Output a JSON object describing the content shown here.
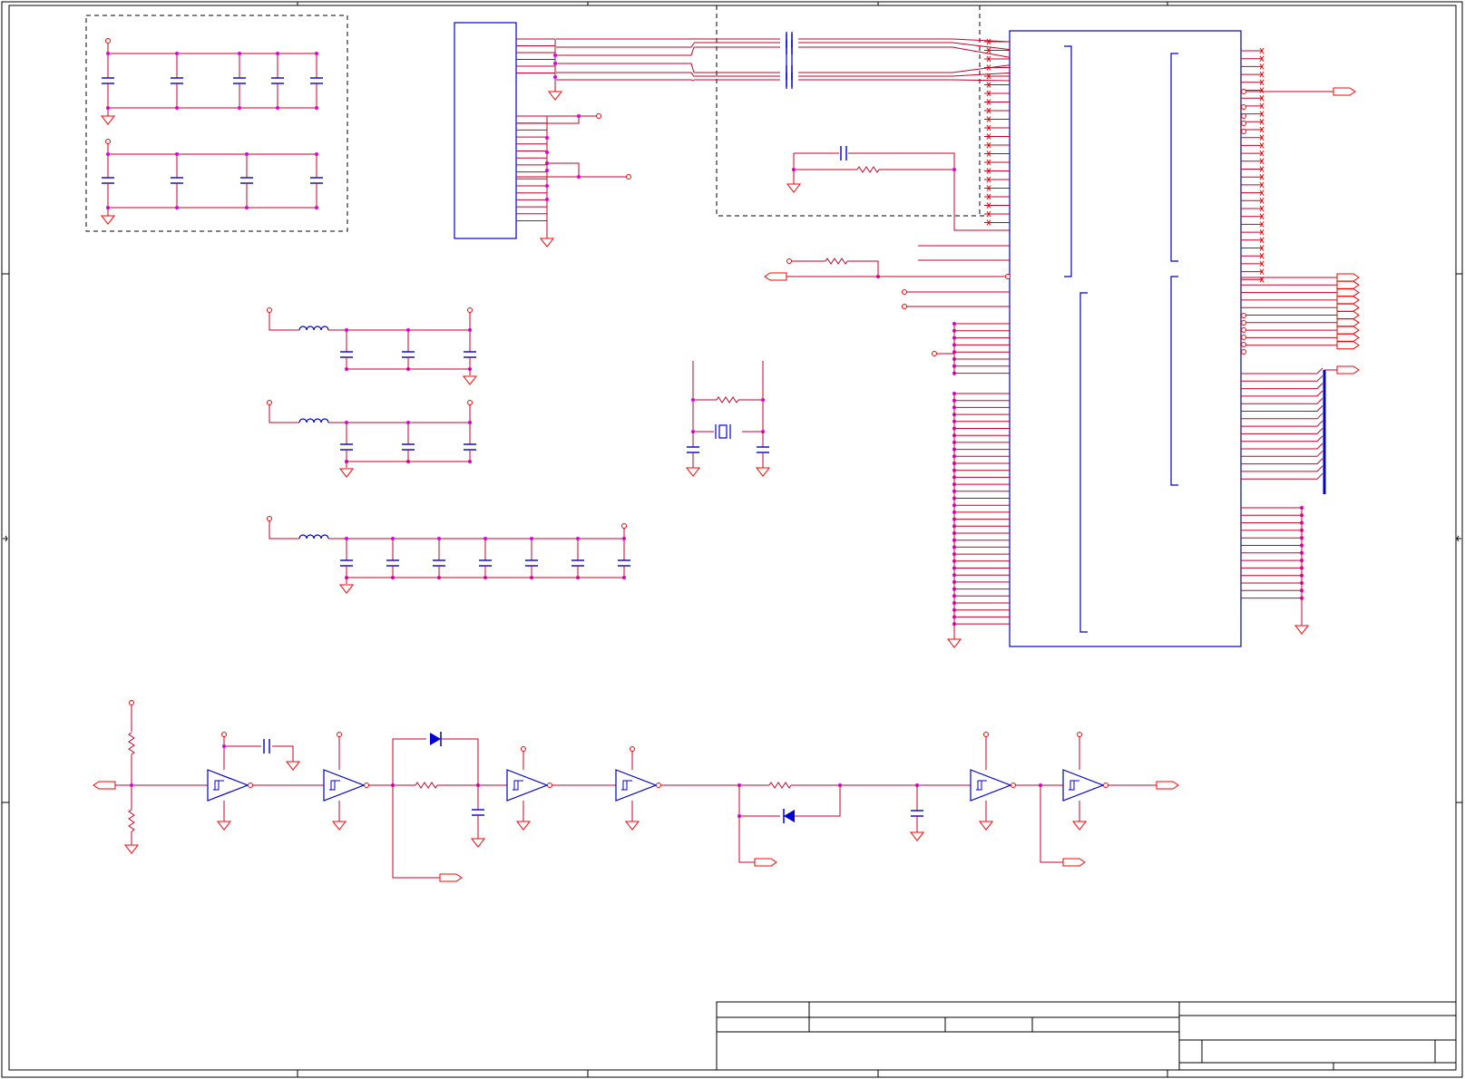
{
  "sheet": {
    "title_block": {
      "title": "",
      "size": "",
      "document_number": "",
      "revision": "",
      "date": "",
      "sheet": ""
    },
    "colors": {
      "wire": "#c8002a",
      "pin": "#ff0000",
      "component": "#0000cc",
      "junction": "#e000e0",
      "border": "#000000",
      "group_box": "#000000"
    }
  },
  "components": {
    "connector": {
      "type": "connector",
      "icon": "connector-icon"
    },
    "main_ic": {
      "type": "integrated-circuit",
      "icon": "ic-icon"
    },
    "crystal": {
      "type": "crystal",
      "icon": "crystal-icon"
    },
    "decoupling_groups": 2,
    "lc_filters": 3,
    "schmitt_buffers": 6,
    "diodes": 2
  }
}
